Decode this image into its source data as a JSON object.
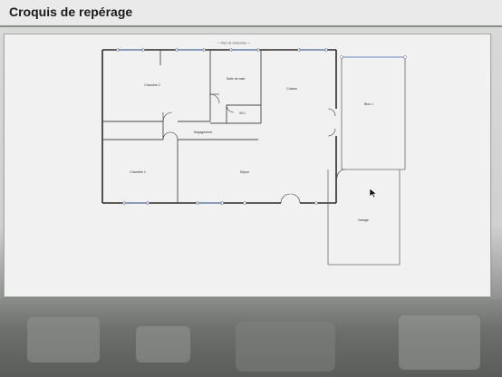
{
  "header": {
    "title": "Croquis de repérage"
  },
  "plan": {
    "level_label": "— Rez de chaussée —",
    "rooms": {
      "chambre2": "Chambre 2",
      "salle_de_bain": "Salle de bain",
      "wc": "W.C.",
      "cuisine": "Cuisine",
      "degagement": "Dégagement",
      "chambre1": "Chambre 1",
      "sejour": "Séjour",
      "bloc1": "Bloc 1",
      "garage": "Garage"
    }
  },
  "colors": {
    "wall": "#2b2b2b",
    "thin_wall": "#6a6a6a",
    "opening": "#8aa0c8"
  }
}
